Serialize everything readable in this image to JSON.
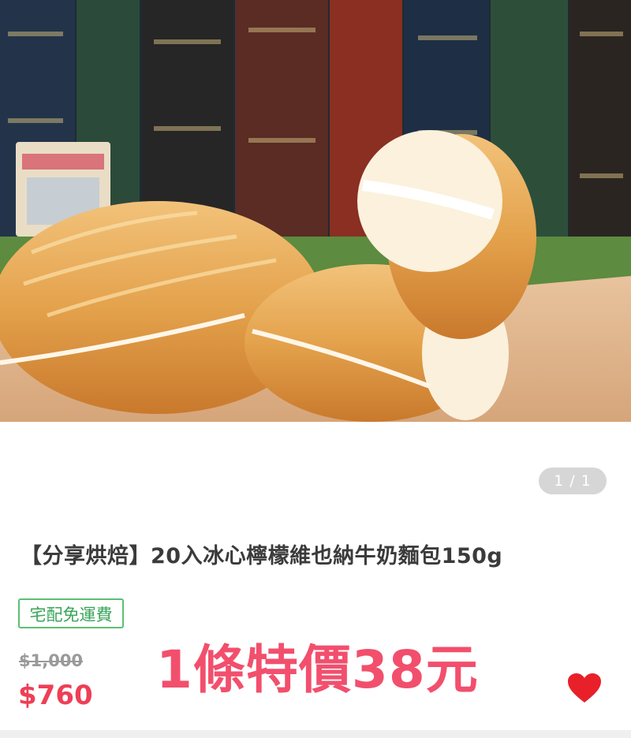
{
  "gallery": {
    "pager": "1 / 1"
  },
  "product": {
    "title": "【分享烘焙】20入冰心檸檬維也納牛奶麵包150g",
    "badge": "宅配免運費",
    "original_price": "$1,000",
    "sale_price": "$760",
    "promo_text": "1條特價38元"
  },
  "colors": {
    "sale": "#ee3f56",
    "promo": "#f24f6d",
    "badge": "#3aa55a",
    "heart": "#e8202a"
  },
  "icons": {
    "favorite": "heart-icon"
  }
}
